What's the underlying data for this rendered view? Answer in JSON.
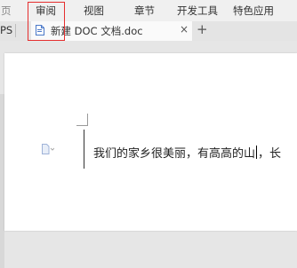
{
  "menu": {
    "items": [
      {
        "label": "页"
      },
      {
        "label": "审阅"
      },
      {
        "label": "视图"
      },
      {
        "label": "章节"
      },
      {
        "label": "开发工具"
      },
      {
        "label": "特色应用"
      }
    ]
  },
  "tabs": {
    "prev_label": "PS",
    "active_title": "新建 DOC 文档.doc",
    "close_glyph": "×",
    "new_tab_glyph": "+"
  },
  "document": {
    "text_before_caret": "我们的家乡很美丽，有高高的山",
    "text_after_caret": "，长"
  },
  "colors": {
    "highlight": "#e52e2e",
    "page": "#ffffff",
    "workspace": "#e6e6e6"
  }
}
